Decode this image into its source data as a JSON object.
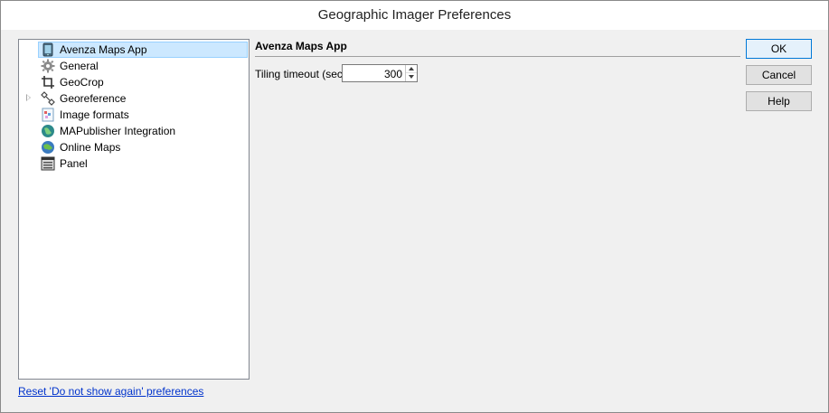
{
  "window": {
    "title": "Geographic Imager Preferences"
  },
  "tree": {
    "items": [
      {
        "label": "Avenza Maps App",
        "icon": "phone-map-icon",
        "selected": true,
        "expandable": false
      },
      {
        "label": "General",
        "icon": "gear-icon",
        "selected": false,
        "expandable": false
      },
      {
        "label": "GeoCrop",
        "icon": "crop-icon",
        "selected": false,
        "expandable": false
      },
      {
        "label": "Georeference",
        "icon": "georeference-icon",
        "selected": false,
        "expandable": true
      },
      {
        "label": "Image formats",
        "icon": "image-formats-icon",
        "selected": false,
        "expandable": false
      },
      {
        "label": "MAPublisher Integration",
        "icon": "globe-icon",
        "selected": false,
        "expandable": false
      },
      {
        "label": "Online Maps",
        "icon": "online-globe-icon",
        "selected": false,
        "expandable": false
      },
      {
        "label": "Panel",
        "icon": "panel-icon",
        "selected": false,
        "expandable": false
      }
    ]
  },
  "panel": {
    "title": "Avenza Maps App",
    "tiling_timeout_label": "Tiling timeout (sec)",
    "tiling_timeout_value": "300"
  },
  "buttons": {
    "ok": "OK",
    "cancel": "Cancel",
    "help": "Help"
  },
  "reset_link": "Reset 'Do not show again' preferences",
  "colors": {
    "selection": "#cce8ff",
    "link": "#0033cc",
    "default_button_border": "#0078d7"
  }
}
